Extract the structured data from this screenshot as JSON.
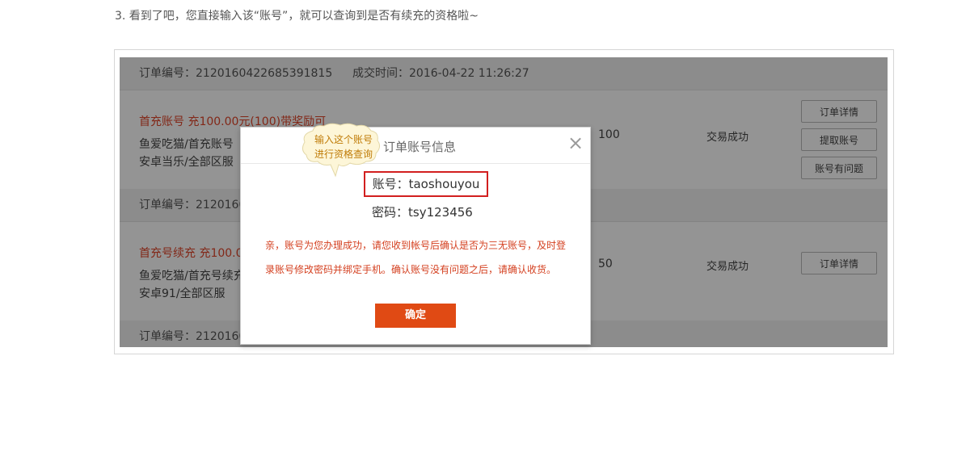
{
  "step_instruction": "3. 看到了吧，您直接输入该“账号”，就可以查询到是否有续充的资格啦~",
  "orders": [
    {
      "order_no": "订单编号：2120160422685391815",
      "deal_time": "成交时间：2016-04-22 11:26:27",
      "title": "首充账号 充100.00元(100)带奖励可",
      "sub1": "鱼爱吃猫/首充账号",
      "sub2": "安卓当乐/全部区服",
      "amount": "100",
      "status": "交易成功",
      "buttons": [
        "订单详情",
        "提取账号",
        "账号有问题"
      ]
    },
    {
      "order_no": "订单编号：2120160",
      "title": "首充号续充 充100.0",
      "sub1": "鱼爱吃猫/首充号续充",
      "sub2": "安卓91/全部区服",
      "amount": "50",
      "status": "交易成功",
      "buttons": [
        "订单详情"
      ]
    },
    {
      "order_no": "订单编号：2120160"
    }
  ],
  "modal": {
    "title": "订单账号信息",
    "account": "账号：taoshouyou",
    "password": "密码：tsy123456",
    "notice_line1": "亲，账号为您办理成功，请您收到帐号后确认是否为三无账号，及时登",
    "notice_line2": "录账号修改密码并绑定手机。确认账号没有问题之后，请确认收货。",
    "confirm_label": "确定",
    "close_glyph": "×"
  },
  "tooltip": {
    "line1": "输入这个账号",
    "line2": "进行资格查询"
  },
  "colors": {
    "accent": "#e04a14",
    "highlight_border": "#d21f1f",
    "notice_text": "#d44020",
    "bubble_fill": "#fdf6d8",
    "bubble_text": "#c07c08"
  }
}
